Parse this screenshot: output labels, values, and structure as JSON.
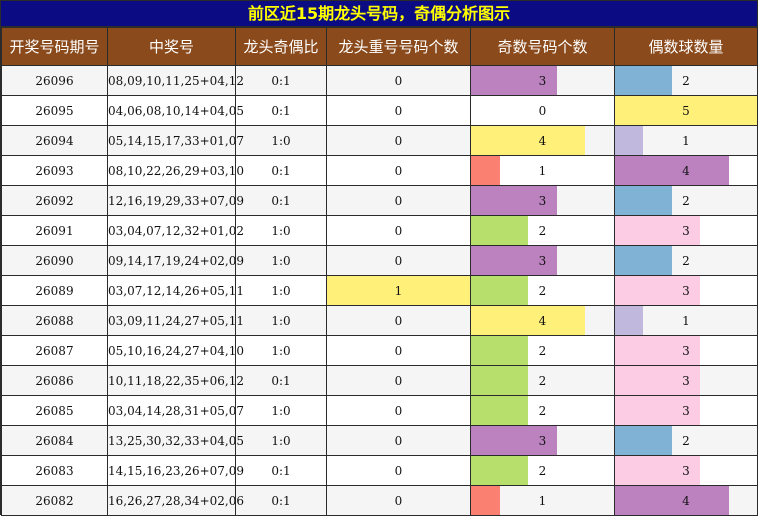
{
  "title": "前区近15期龙头号码，奇偶分析图示",
  "headers": [
    "开奖号码期号",
    "中奖号",
    "龙头奇偶比",
    "龙头重号号码个数",
    "奇数号码个数",
    "偶数球数量"
  ],
  "max_count": 5,
  "colors": {
    "0": "#ffffff",
    "1": "#fa8072",
    "2": "#b6df6b",
    "3": "#bc82bf",
    "4": "#fff07a",
    "5": "#fff07a",
    "even_1": "#c0b8dd",
    "even_2": "#80b2d6",
    "even_3": "#fbcce4",
    "even_4": "#bc82bf",
    "even_5": "#fff07a"
  },
  "rows": [
    {
      "period": "26096",
      "numbers": "08,09,10,11,25+04,12",
      "ratio": "0:1",
      "repeat": "0",
      "odd": 3,
      "even": 2
    },
    {
      "period": "26095",
      "numbers": "04,06,08,10,14+04,05",
      "ratio": "0:1",
      "repeat": "0",
      "odd": 0,
      "even": 5
    },
    {
      "period": "26094",
      "numbers": "05,14,15,17,33+01,07",
      "ratio": "1:0",
      "repeat": "0",
      "odd": 4,
      "even": 1
    },
    {
      "period": "26093",
      "numbers": "08,10,22,26,29+03,10",
      "ratio": "0:1",
      "repeat": "0",
      "odd": 1,
      "even": 4
    },
    {
      "period": "26092",
      "numbers": "12,16,19,29,33+07,09",
      "ratio": "0:1",
      "repeat": "0",
      "odd": 3,
      "even": 2
    },
    {
      "period": "26091",
      "numbers": "03,04,07,12,32+01,02",
      "ratio": "1:0",
      "repeat": "0",
      "odd": 2,
      "even": 3
    },
    {
      "period": "26090",
      "numbers": "09,14,17,19,24+02,09",
      "ratio": "1:0",
      "repeat": "0",
      "odd": 3,
      "even": 2
    },
    {
      "period": "26089",
      "numbers": "03,07,12,14,26+05,11",
      "ratio": "1:0",
      "repeat": "1",
      "odd": 2,
      "even": 3
    },
    {
      "period": "26088",
      "numbers": "03,09,11,24,27+05,11",
      "ratio": "1:0",
      "repeat": "0",
      "odd": 4,
      "even": 1
    },
    {
      "period": "26087",
      "numbers": "05,10,16,24,27+04,10",
      "ratio": "1:0",
      "repeat": "0",
      "odd": 2,
      "even": 3
    },
    {
      "period": "26086",
      "numbers": "10,11,18,22,35+06,12",
      "ratio": "0:1",
      "repeat": "0",
      "odd": 2,
      "even": 3
    },
    {
      "period": "26085",
      "numbers": "03,04,14,28,31+05,07",
      "ratio": "1:0",
      "repeat": "0",
      "odd": 2,
      "even": 3
    },
    {
      "period": "26084",
      "numbers": "13,25,30,32,33+04,05",
      "ratio": "1:0",
      "repeat": "0",
      "odd": 3,
      "even": 2
    },
    {
      "period": "26083",
      "numbers": "14,15,16,23,26+07,09",
      "ratio": "0:1",
      "repeat": "0",
      "odd": 2,
      "even": 3
    },
    {
      "period": "26082",
      "numbers": "16,26,27,28,34+02,06",
      "ratio": "0:1",
      "repeat": "0",
      "odd": 1,
      "even": 4
    }
  ]
}
